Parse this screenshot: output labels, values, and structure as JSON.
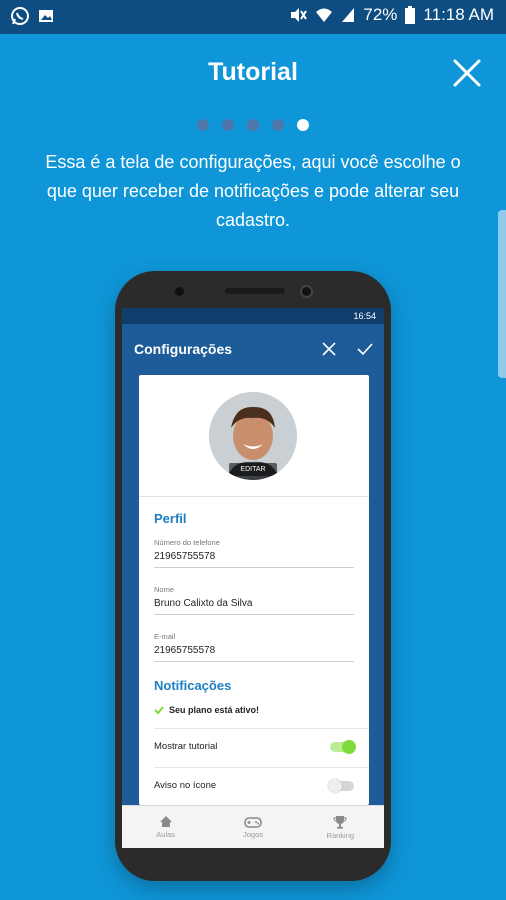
{
  "status_bar": {
    "battery": "72%",
    "time": "11:18 AM"
  },
  "header": {
    "title": "Tutorial"
  },
  "pager": {
    "total": 5,
    "active_index": 4
  },
  "description": "Essa é a tela de configurações, aqui você escolhe o que quer receber de notificações e pode alterar seu cadastro.",
  "mockup": {
    "status_time": "16:54",
    "appbar_title": "Configurações",
    "edit_badge": "EDITAR",
    "profile_section": "Perfil",
    "fields": [
      {
        "label": "Número do telefone",
        "value": "21965755578"
      },
      {
        "label": "Nome",
        "value": "Bruno Calixto da Silva"
      },
      {
        "label": "E-mail",
        "value": "21965755578"
      }
    ],
    "notifications_section": "Notificações",
    "plan_status": "Seu plano está ativo!",
    "toggles": [
      {
        "label": "Mostrar tutorial",
        "on": true
      },
      {
        "label": "Aviso no ícone",
        "on": false
      }
    ],
    "nav": [
      {
        "label": "Aulas",
        "icon": "home-icon"
      },
      {
        "label": "Jogos",
        "icon": "gamepad-icon"
      },
      {
        "label": "Ranking",
        "icon": "trophy-icon"
      }
    ]
  },
  "colors": {
    "background": "#0f96d8",
    "status_bar": "#0d4d82",
    "accent_green": "#7ddc3a",
    "section_blue": "#1d7fc1"
  }
}
